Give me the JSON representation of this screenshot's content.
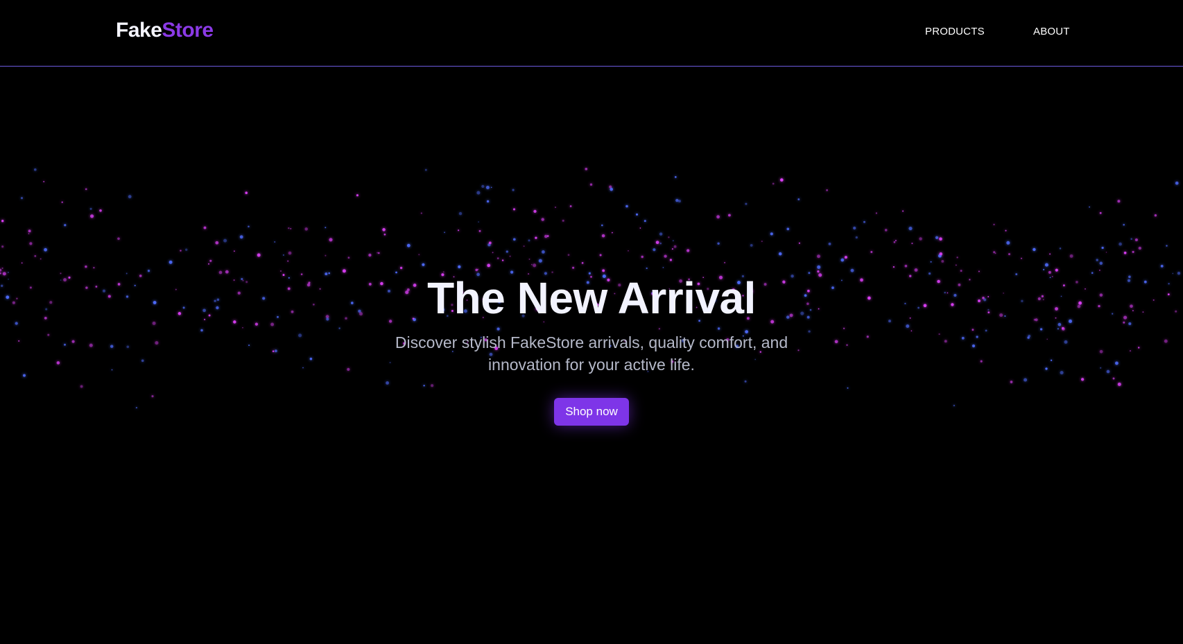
{
  "header": {
    "logo_part1": "Fake",
    "logo_part2": "Store",
    "nav": [
      "PRODUCTS",
      "ABOUT"
    ]
  },
  "hero": {
    "title": "The New Arrival",
    "subtitle": "Discover stylish FakeStore arrivals, quality comfort, and innovation for your active life.",
    "cta_label": "Shop now"
  },
  "colors": {
    "background": "#000000",
    "accent": "#7e35e8",
    "logo_accent": "#8b3ae6",
    "divider": "#6d5ce0",
    "particle_pink": "#e040fb",
    "particle_blue": "#4f6cff"
  }
}
